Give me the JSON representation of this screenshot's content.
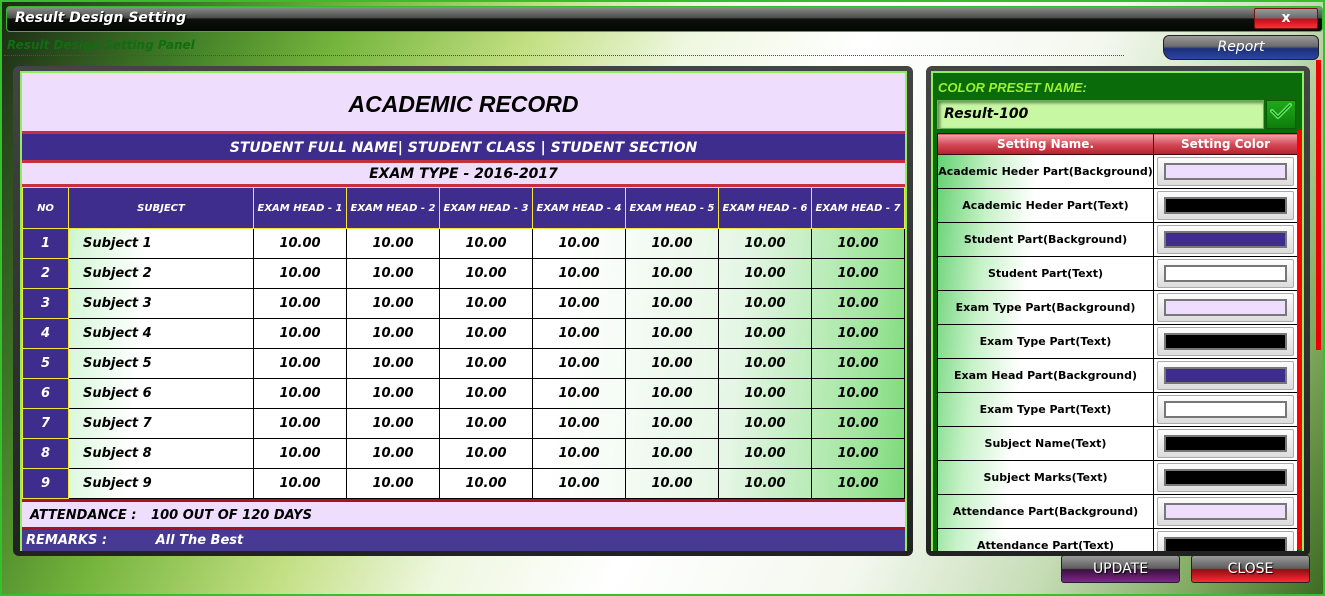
{
  "window": {
    "title": "Result Design Setting",
    "close_label": "x"
  },
  "panel": {
    "title": "Result Design Setting Panel",
    "report_label": "Report"
  },
  "report": {
    "academic_title": "ACADEMIC RECORD",
    "student_line": "STUDENT FULL NAME| STUDENT CLASS | STUDENT SECTION",
    "exam_type": "EXAM TYPE - 2016-2017",
    "columns": [
      "NO",
      "SUBJECT",
      "EXAM HEAD - 1",
      "EXAM HEAD - 2",
      "EXAM HEAD - 3",
      "EXAM HEAD - 4",
      "EXAM HEAD - 5",
      "EXAM HEAD - 6",
      "EXAM HEAD - 7"
    ],
    "rows": [
      {
        "no": "1",
        "subject": "Subject 1",
        "marks": [
          "10.00",
          "10.00",
          "10.00",
          "10.00",
          "10.00",
          "10.00",
          "10.00"
        ]
      },
      {
        "no": "2",
        "subject": "Subject 2",
        "marks": [
          "10.00",
          "10.00",
          "10.00",
          "10.00",
          "10.00",
          "10.00",
          "10.00"
        ]
      },
      {
        "no": "3",
        "subject": "Subject 3",
        "marks": [
          "10.00",
          "10.00",
          "10.00",
          "10.00",
          "10.00",
          "10.00",
          "10.00"
        ]
      },
      {
        "no": "4",
        "subject": "Subject 4",
        "marks": [
          "10.00",
          "10.00",
          "10.00",
          "10.00",
          "10.00",
          "10.00",
          "10.00"
        ]
      },
      {
        "no": "5",
        "subject": "Subject 5",
        "marks": [
          "10.00",
          "10.00",
          "10.00",
          "10.00",
          "10.00",
          "10.00",
          "10.00"
        ]
      },
      {
        "no": "6",
        "subject": "Subject 6",
        "marks": [
          "10.00",
          "10.00",
          "10.00",
          "10.00",
          "10.00",
          "10.00",
          "10.00"
        ]
      },
      {
        "no": "7",
        "subject": "Subject 7",
        "marks": [
          "10.00",
          "10.00",
          "10.00",
          "10.00",
          "10.00",
          "10.00",
          "10.00"
        ]
      },
      {
        "no": "8",
        "subject": "Subject 8",
        "marks": [
          "10.00",
          "10.00",
          "10.00",
          "10.00",
          "10.00",
          "10.00",
          "10.00"
        ]
      },
      {
        "no": "9",
        "subject": "Subject 9",
        "marks": [
          "10.00",
          "10.00",
          "10.00",
          "10.00",
          "10.00",
          "10.00",
          "10.00"
        ]
      }
    ],
    "attendance_label": "ATTENDANCE :",
    "attendance_value": "100 OUT OF  120 DAYS",
    "remarks_label": "REMARKS :",
    "remarks_value": "All The Best"
  },
  "settings": {
    "preset_label": "COLOR PRESET NAME:",
    "preset_value": "Result-100",
    "confirm_icon": "check-icon",
    "headers": [
      "Setting Name.",
      "Setting Color"
    ],
    "items": [
      {
        "name": "Academic Heder Part(Background)",
        "color": "#eeddfc"
      },
      {
        "name": "Academic Heder Part(Text)",
        "color": "#000000"
      },
      {
        "name": "Student Part(Background)",
        "color": "#3e2d8c"
      },
      {
        "name": "Student Part(Text)",
        "color": "#ffffff"
      },
      {
        "name": "Exam Type Part(Background)",
        "color": "#eeddfc"
      },
      {
        "name": "Exam Type Part(Text)",
        "color": "#000000"
      },
      {
        "name": "Exam Head Part(Background)",
        "color": "#3e2d8c"
      },
      {
        "name": "Exam Type Part(Text)",
        "color": "#ffffff"
      },
      {
        "name": "Subject Name(Text)",
        "color": "#000000"
      },
      {
        "name": "Subject Marks(Text)",
        "color": "#000000"
      },
      {
        "name": "Attendance Part(Background)",
        "color": "#eeddfc"
      },
      {
        "name": "Attendance Part(Text)",
        "color": "#000000"
      }
    ]
  },
  "footer": {
    "update_label": "UPDATE",
    "close_label": "CLOSE"
  }
}
